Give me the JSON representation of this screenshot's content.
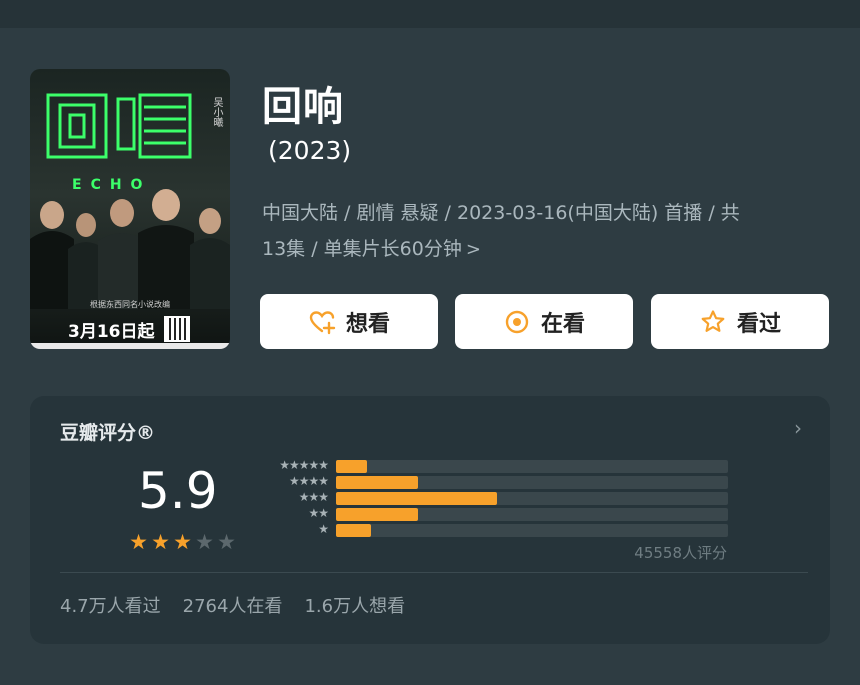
{
  "poster": {
    "title_logo": "回响",
    "echo": "ECHO",
    "side_text": "吴小曦",
    "tagline": "根据东西同名小说改编",
    "date": "3月16日起"
  },
  "title": "回响",
  "year": "(2023)",
  "meta": {
    "line1": "中国大陆 / 剧情 悬疑 / 2023-03-16(中国大陆) 首播 / 共",
    "line2": "13集 / 单集片长60分钟",
    "chevron": ">"
  },
  "buttons": {
    "want": "想看",
    "watching": "在看",
    "watched": "看过"
  },
  "colors": {
    "accent": "#f7a12b",
    "background": "#2e3c42",
    "card": "#26343a"
  },
  "rating": {
    "title": "豆瓣评分®",
    "score": "5.9",
    "stars_filled": 3,
    "stars_total": 5,
    "distribution": [
      {
        "stars": "★★★★★",
        "fraction": 0.08
      },
      {
        "stars": "★★★★",
        "fraction": 0.21
      },
      {
        "stars": "★★★",
        "fraction": 0.41
      },
      {
        "stars": "★★",
        "fraction": 0.21
      },
      {
        "stars": "★",
        "fraction": 0.09
      }
    ],
    "count": "45558人评分"
  },
  "stats": {
    "watched": "4.7万人看过",
    "watching": "2764人在看",
    "want": "1.6万人想看"
  }
}
